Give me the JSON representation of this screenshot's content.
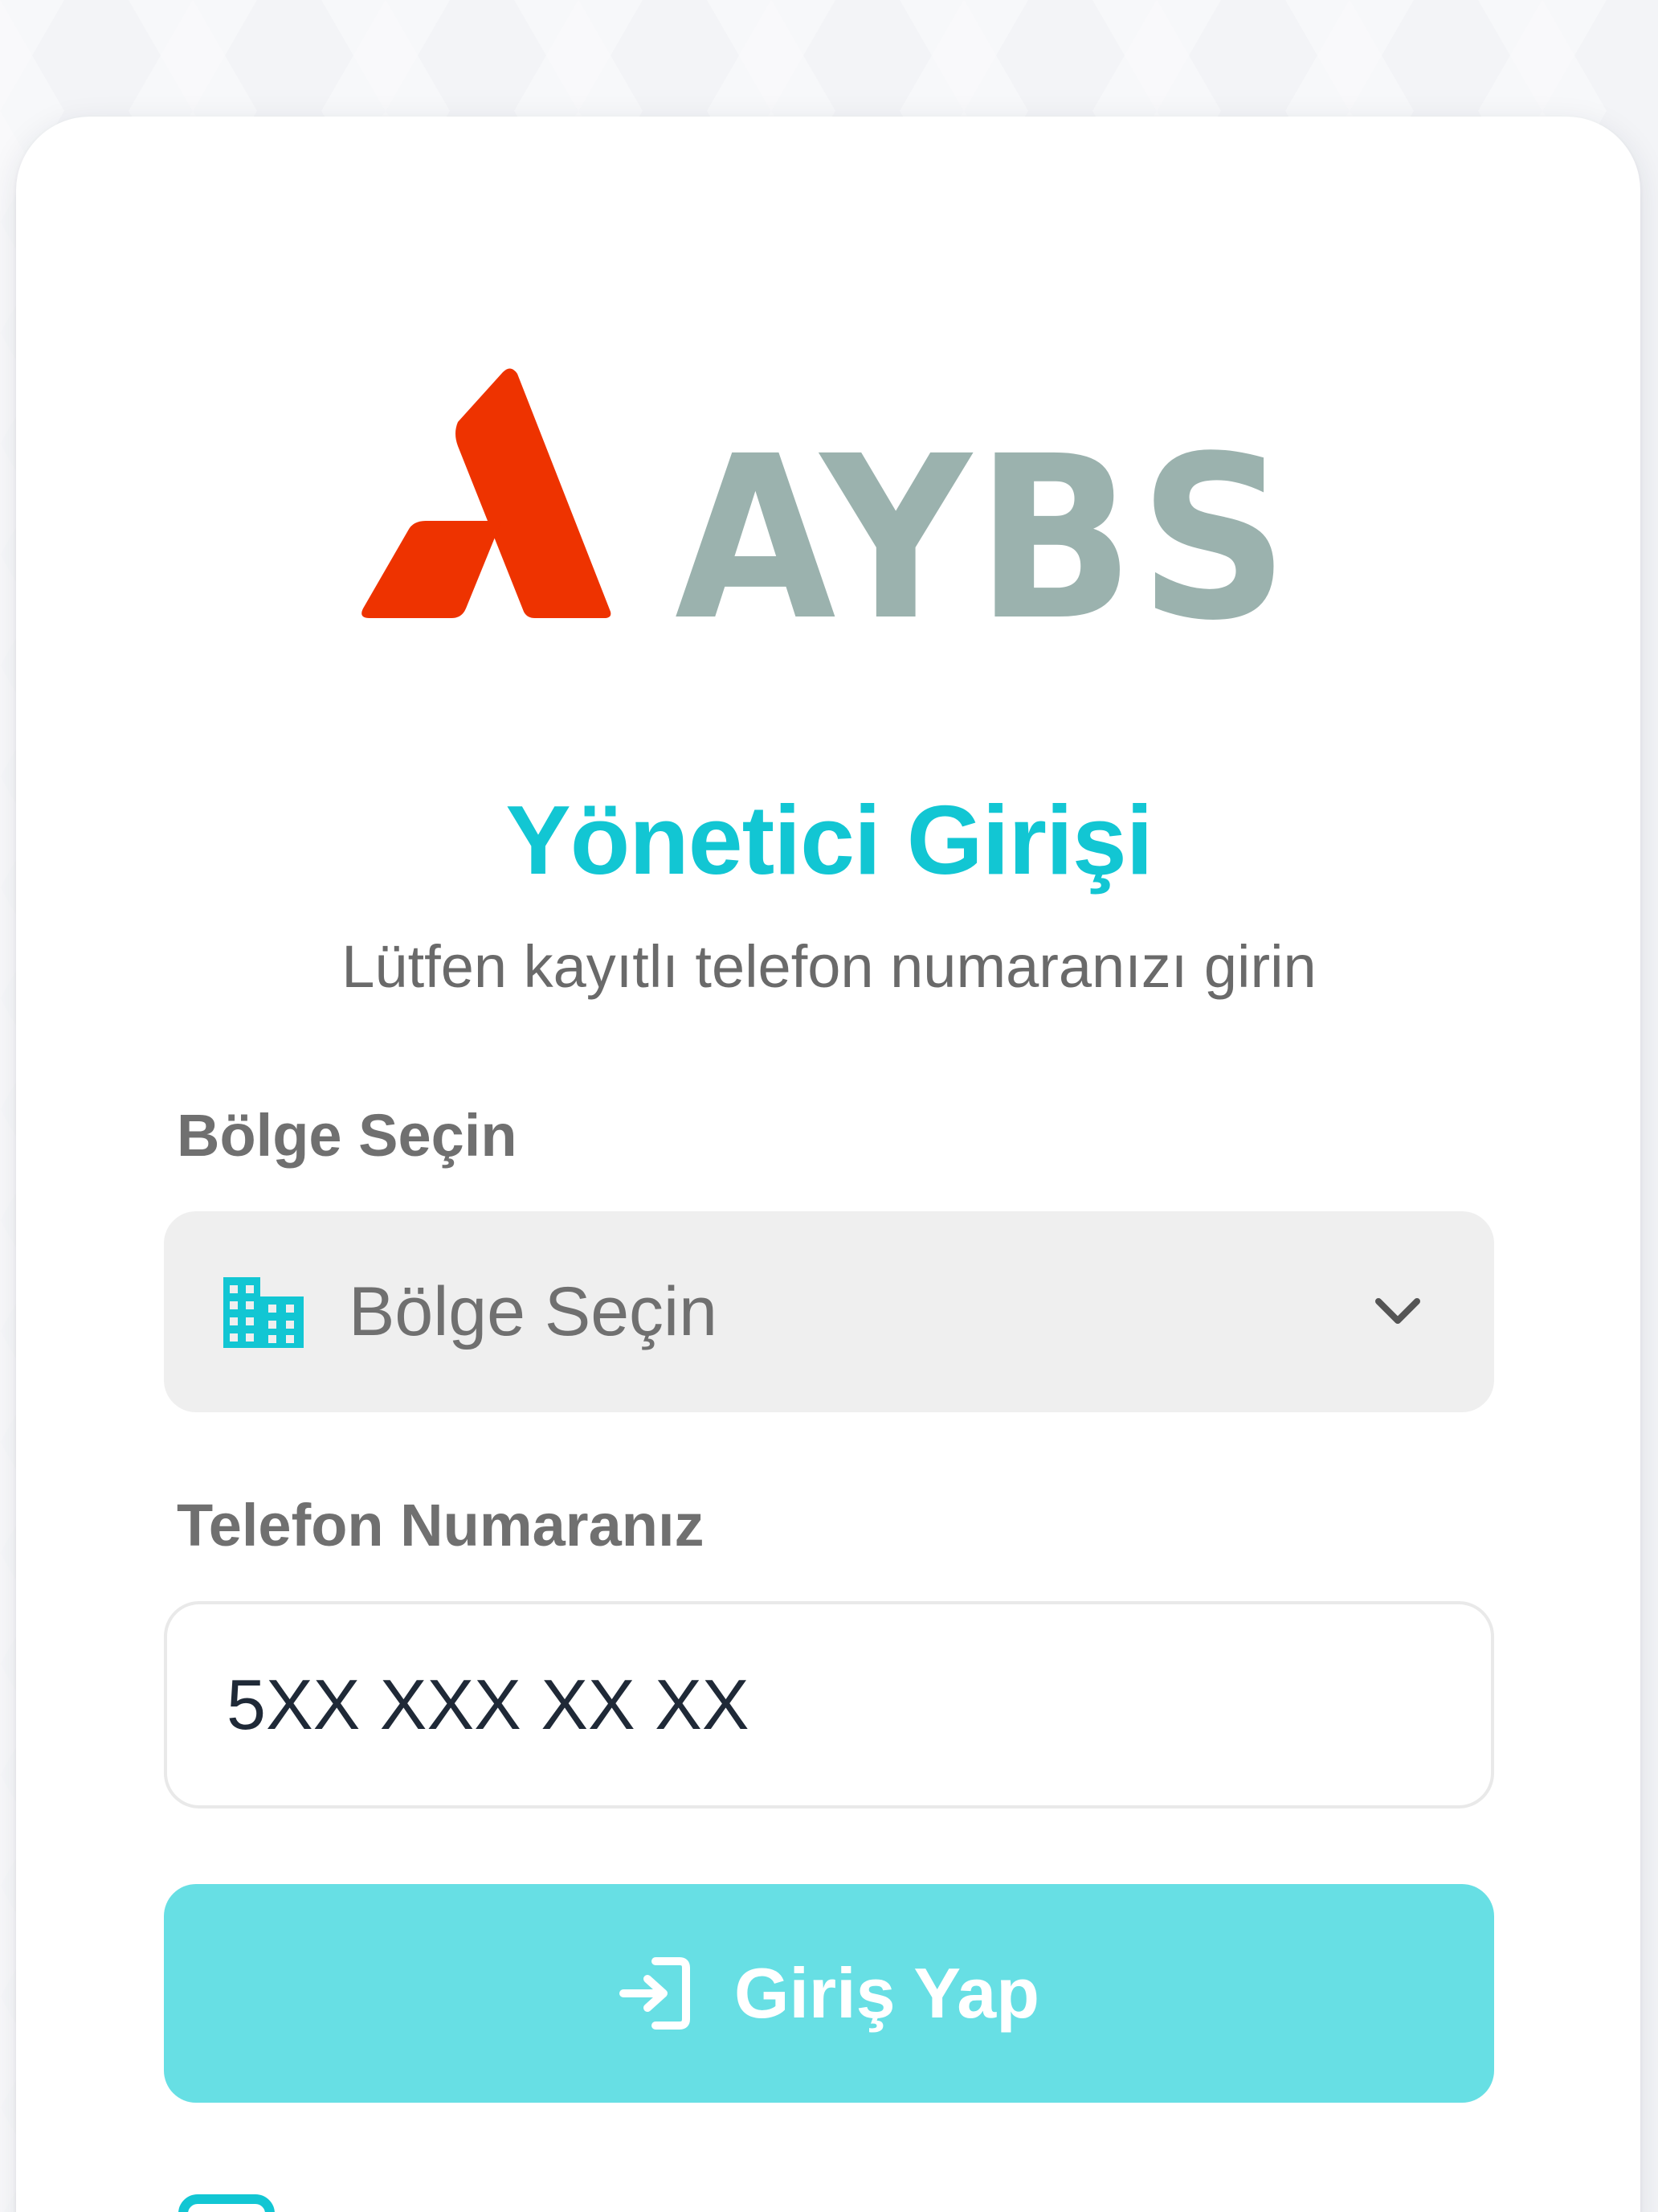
{
  "brand": {
    "name": "AYBS",
    "mark_color": "#ee3300",
    "text_color": "#9bb2ae"
  },
  "login": {
    "title": "Yönetici Girişi",
    "subtitle": "Lütfen kayıtlı telefon numaranızı girin"
  },
  "region": {
    "label": "Bölge Seçin",
    "selected": "Bölge Seçin",
    "icon": "building-icon"
  },
  "phone": {
    "label": "Telefon Numaranız",
    "placeholder": "5XX XXX XX XX",
    "value": ""
  },
  "submit": {
    "label": "Giriş Yap",
    "icon": "login-icon"
  },
  "colors": {
    "accent": "#12c6d3",
    "button": "#67dfe4",
    "background": "#f3f4f7"
  }
}
